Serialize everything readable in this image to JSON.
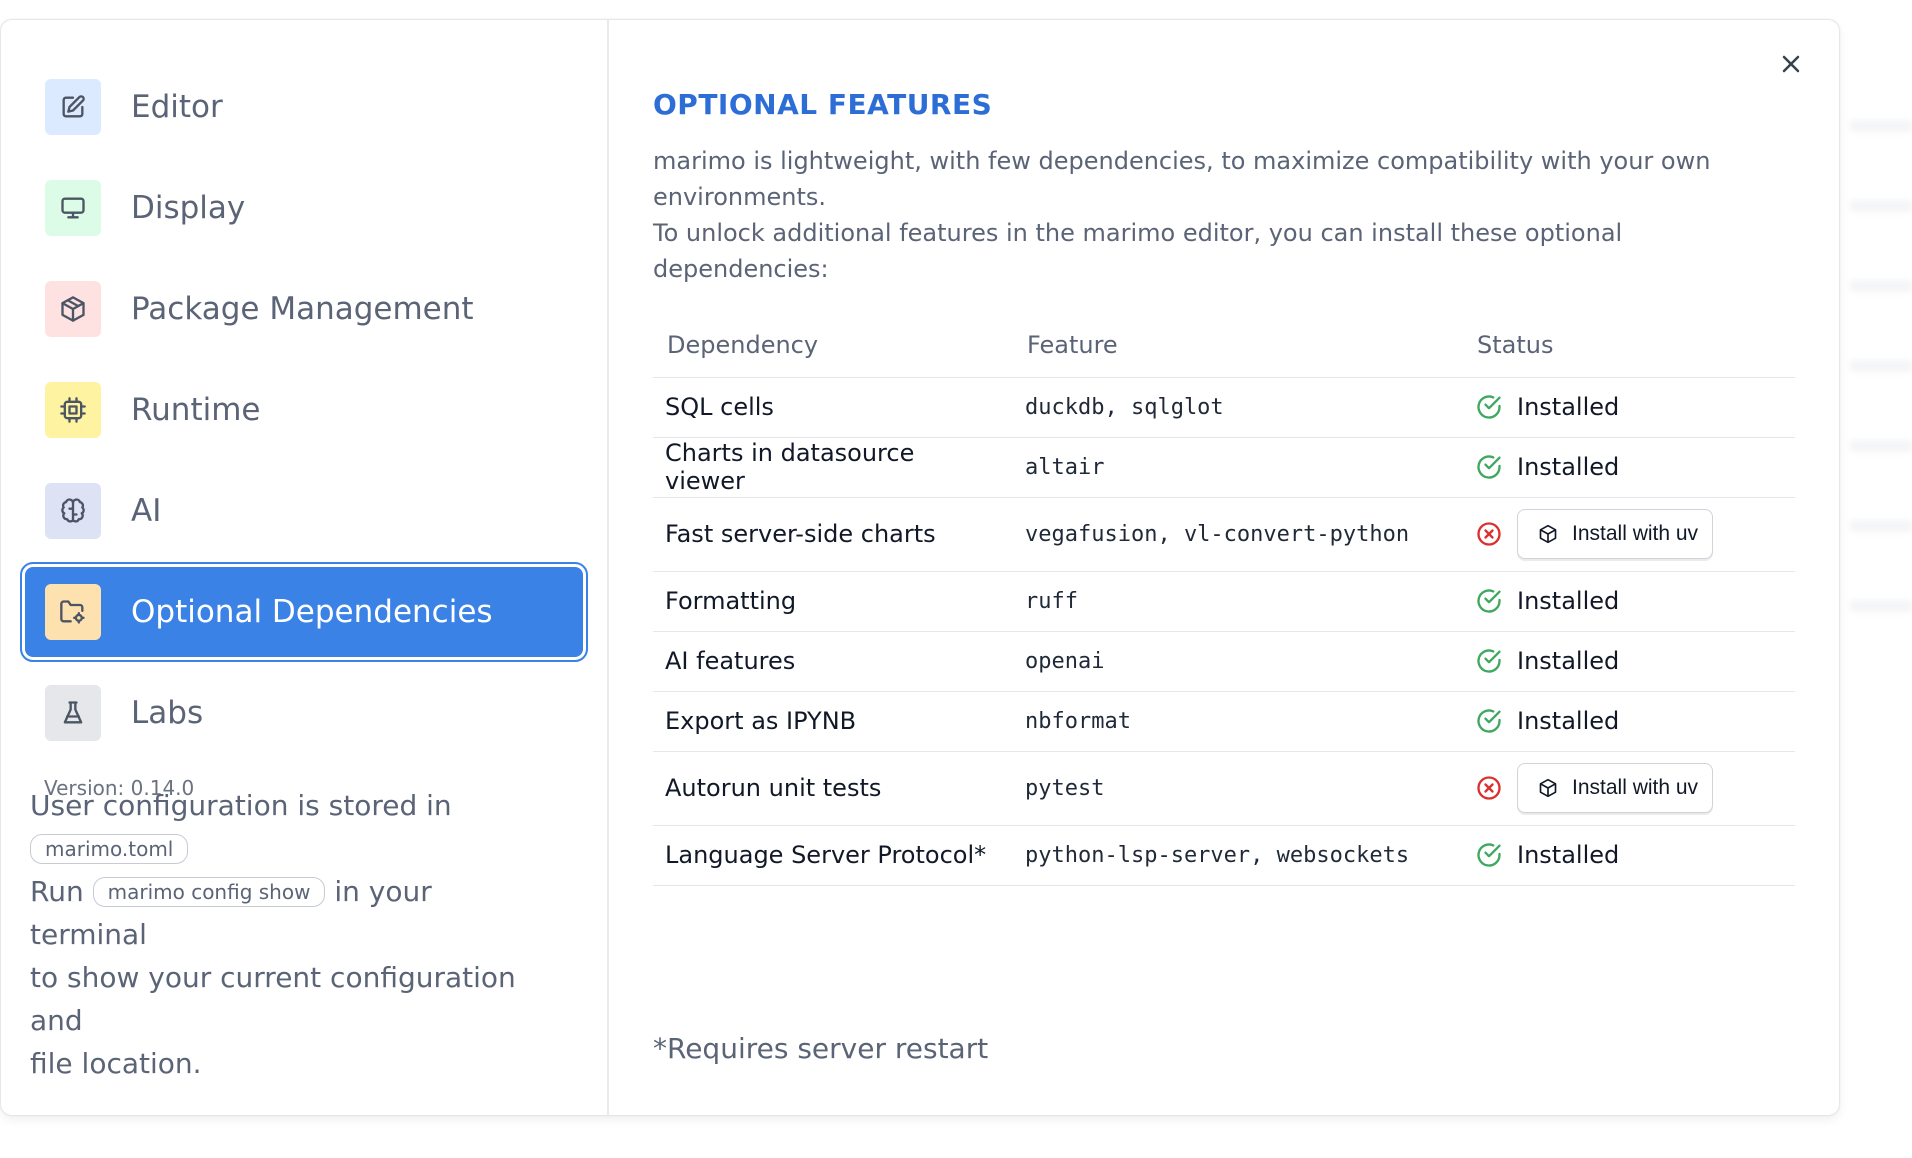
{
  "sidebar": {
    "items": [
      {
        "label": "Editor",
        "icon": "edit-icon",
        "bg": "#dbeafe",
        "stroke": "#4b5563"
      },
      {
        "label": "Display",
        "icon": "monitor-icon",
        "bg": "#dcfce7",
        "stroke": "#4b5563"
      },
      {
        "label": "Package Management",
        "icon": "package-icon",
        "bg": "#fee2e2",
        "stroke": "#4b5563"
      },
      {
        "label": "Runtime",
        "icon": "cpu-icon",
        "bg": "#fef3a1",
        "stroke": "#4b5563"
      },
      {
        "label": "AI",
        "icon": "brain-icon",
        "bg": "#dde3f5",
        "stroke": "#4b5563"
      },
      {
        "label": "Optional Dependencies",
        "icon": "folder-cog-icon",
        "bg": "#fde2b0",
        "stroke": "#4b5563",
        "active": true
      },
      {
        "label": "Labs",
        "icon": "flask-icon",
        "bg": "#e5e7eb",
        "stroke": "#4b5563"
      }
    ],
    "version": "Version: 0.14.0",
    "config_note": {
      "line1_prefix": "User configuration is stored in",
      "file_pill": "marimo.toml",
      "run_word": "Run",
      "command_pill": "marimo config show",
      "line2_suffix": "in your terminal",
      "line3": "to show your current configuration and",
      "line4": "file location."
    }
  },
  "main": {
    "title": "OPTIONAL FEATURES",
    "description_line1": "marimo is lightweight, with few dependencies, to maximize compatibility with your own environments.",
    "description_line2": "To unlock additional features in the marimo editor, you can install these optional dependencies:",
    "columns": [
      "Dependency",
      "Feature",
      "Status"
    ],
    "rows": [
      {
        "dependency": "SQL cells",
        "feature": "duckdb, sqlglot",
        "installed": true,
        "status": "Installed"
      },
      {
        "dependency": "Charts in datasource viewer",
        "feature": "altair",
        "installed": true,
        "status": "Installed"
      },
      {
        "dependency": "Fast server-side charts",
        "feature": "vegafusion, vl-convert-python",
        "installed": false,
        "status": "Install with uv"
      },
      {
        "dependency": "Formatting",
        "feature": "ruff",
        "installed": true,
        "status": "Installed"
      },
      {
        "dependency": "AI features",
        "feature": "openai",
        "installed": true,
        "status": "Installed"
      },
      {
        "dependency": "Export as IPYNB",
        "feature": "nbformat",
        "installed": true,
        "status": "Installed"
      },
      {
        "dependency": "Autorun unit tests",
        "feature": "pytest",
        "installed": false,
        "status": "Install with uv"
      },
      {
        "dependency": "Language Server Protocol*",
        "feature": "python-lsp-server, websockets",
        "installed": true,
        "status": "Installed"
      }
    ],
    "footnote": "*Requires server restart",
    "colors": {
      "installed": "#3ea85f",
      "missing": "#dc2f2f",
      "accent": "#3b82e6",
      "title": "#2c6ed5"
    }
  }
}
